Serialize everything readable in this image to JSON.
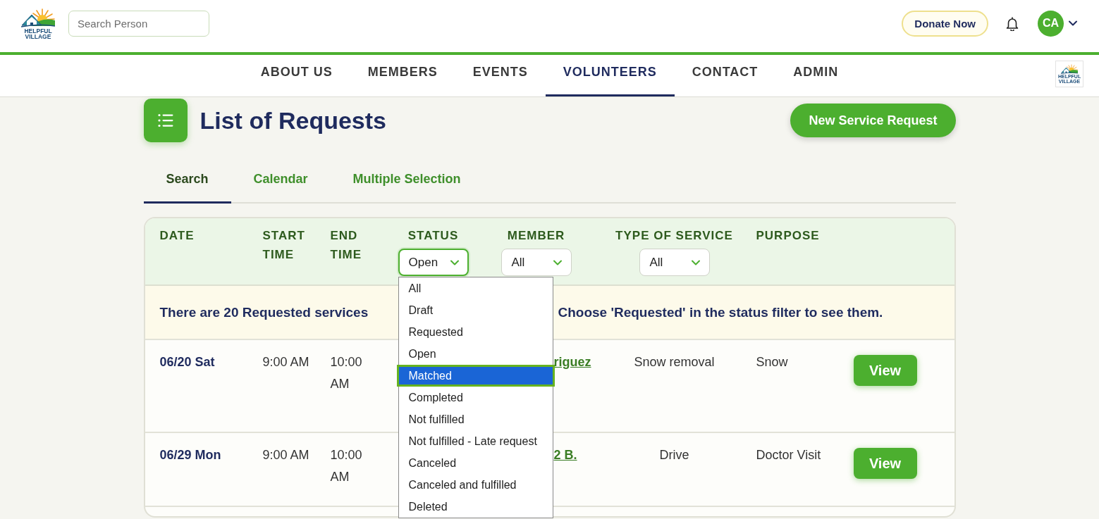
{
  "header": {
    "logo_text": "HELPFUL VILLAGE",
    "search": {
      "placeholder": "Search Person"
    },
    "donate_button": "Donate Now",
    "avatar": "CA"
  },
  "nav": {
    "items": [
      {
        "label": "ABOUT US",
        "selected": false
      },
      {
        "label": "MEMBERS",
        "selected": false
      },
      {
        "label": "EVENTS",
        "selected": false
      },
      {
        "label": "VOLUNTEERS",
        "selected": true
      },
      {
        "label": "CONTACT",
        "selected": false
      },
      {
        "label": "ADMIN",
        "selected": false
      }
    ],
    "logo_text": "HELPFUL VILLAGE"
  },
  "page": {
    "title": "List of Requests",
    "new_button": "New Service Request"
  },
  "tabs": [
    {
      "label": "Search",
      "selected": true
    },
    {
      "label": "Calendar",
      "selected": false
    },
    {
      "label": "Multiple Selection",
      "selected": false
    }
  ],
  "table": {
    "columns": [
      {
        "label": "DATE"
      },
      {
        "label": "START TIME"
      },
      {
        "label": "END TIME"
      },
      {
        "label": "STATUS",
        "filter": {
          "value": "Open",
          "focused": true,
          "options": [
            {
              "label": "All",
              "highlighted": false
            },
            {
              "label": "Draft",
              "highlighted": false
            },
            {
              "label": "Requested",
              "highlighted": false
            },
            {
              "label": "Open",
              "highlighted": false
            },
            {
              "label": "Matched",
              "highlighted": true
            },
            {
              "label": "Completed",
              "highlighted": false
            },
            {
              "label": "Not fulfilled",
              "highlighted": false
            },
            {
              "label": "Not fulfilled - Late request",
              "highlighted": false
            },
            {
              "label": "Canceled",
              "highlighted": false
            },
            {
              "label": "Canceled and fulfilled",
              "highlighted": false
            },
            {
              "label": "Deleted",
              "highlighted": false
            }
          ]
        }
      },
      {
        "label": "MEMBER",
        "filter": {
          "value": "All",
          "focused": false
        }
      },
      {
        "label": "TYPE OF SERVICE",
        "filter": {
          "value": "All",
          "focused": false
        }
      },
      {
        "label": "PURPOSE"
      }
    ],
    "notice": {
      "before": "There are 20 Requested services",
      "after": "Choose 'Requested' in the status filter to see them."
    },
    "rows": [
      {
        "date": "06/20 Sat",
        "start_time": "9:00 AM",
        "end_time": "10:00 AM",
        "member": "riguez",
        "type_of_service": "Snow removal",
        "purpose": "Snow",
        "action": "View"
      },
      {
        "date": "06/29 Mon",
        "start_time": "9:00 AM",
        "end_time": "10:00 AM",
        "member": "2 B.",
        "type_of_service": "Drive",
        "purpose": "Doctor Visit",
        "action": "View"
      }
    ]
  }
}
